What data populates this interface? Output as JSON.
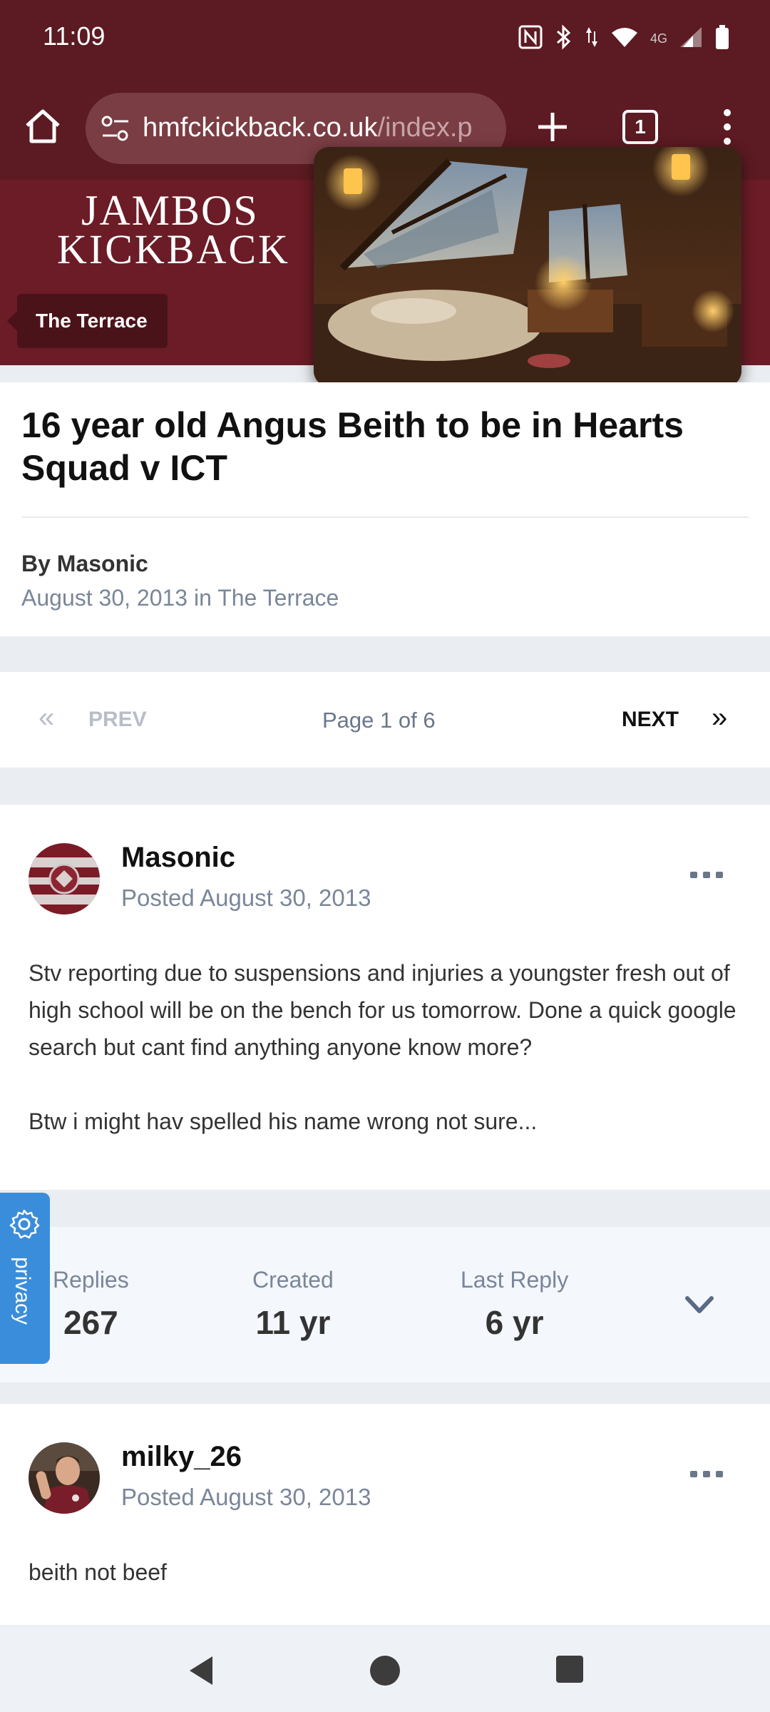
{
  "status_bar": {
    "time": "11:09",
    "network": "4G"
  },
  "browser": {
    "url_main": "hmfckickback.co.uk",
    "url_path": "/index.p",
    "tab_count": "1"
  },
  "site": {
    "logo_line1": "JAMBOS",
    "logo_line2": "KICKBACK",
    "forum_name": "The Terrace"
  },
  "topic": {
    "title": "16 year old Angus Beith to be in Hearts Squad v ICT",
    "by_label": "By",
    "author": "Masonic",
    "date": "August 30, 2013",
    "in_label": "in",
    "forum": "The Terrace"
  },
  "pagination": {
    "prev_label": "PREV",
    "page_info": "Page 1 of 6",
    "next_label": "NEXT"
  },
  "posts": [
    {
      "author": "Masonic",
      "posted": "Posted August 30, 2013",
      "paragraphs": [
        "Stv reporting due to suspensions and injuries a youngster fresh out of high school will be on the bench for us tomorrow. Done a quick google search but cant find anything anyone know more?",
        "Btw i might hav spelled his name wrong not sure..."
      ]
    },
    {
      "author": "milky_26",
      "posted": "Posted August 30, 2013",
      "paragraphs": [
        "beith not beef"
      ]
    }
  ],
  "stats": {
    "replies_label": "Replies",
    "replies_value": "267",
    "created_label": "Created",
    "created_value": "11 yr",
    "last_reply_label": "Last Reply",
    "last_reply_value": "6 yr"
  },
  "privacy": {
    "label": "privacy"
  },
  "colors": {
    "brand_maroon": "#6b1c26",
    "privacy_blue": "#3a8ddb"
  }
}
